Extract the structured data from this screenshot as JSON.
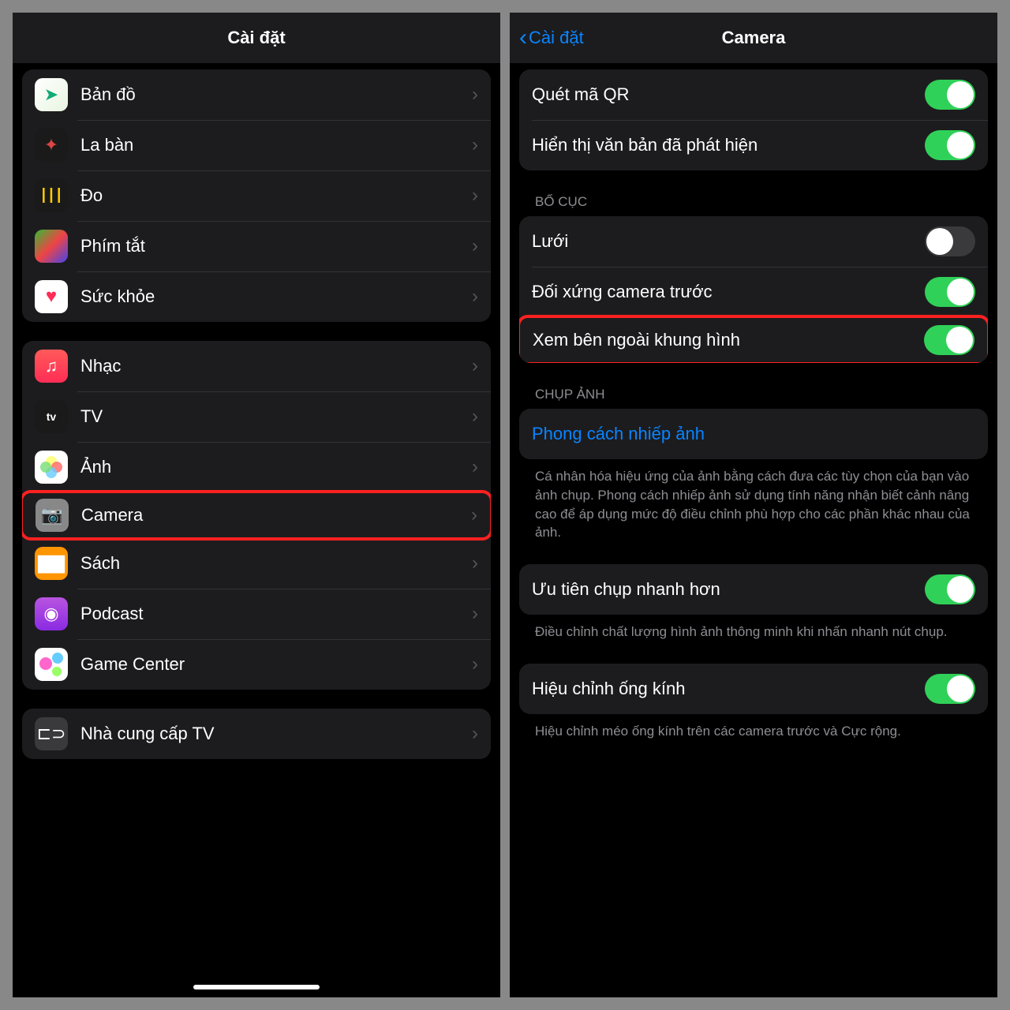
{
  "left": {
    "title": "Cài đặt",
    "group1": [
      {
        "label": "Bản đồ",
        "icon": "maps"
      },
      {
        "label": "La bàn",
        "icon": "compass"
      },
      {
        "label": "Đo",
        "icon": "measure"
      },
      {
        "label": "Phím tắt",
        "icon": "shortcuts"
      },
      {
        "label": "Sức khỏe",
        "icon": "health"
      }
    ],
    "group2": [
      {
        "label": "Nhạc",
        "icon": "music"
      },
      {
        "label": "TV",
        "icon": "tv"
      },
      {
        "label": "Ảnh",
        "icon": "photos"
      },
      {
        "label": "Camera",
        "icon": "camera",
        "highlight": true
      },
      {
        "label": "Sách",
        "icon": "books"
      },
      {
        "label": "Podcast",
        "icon": "podcast"
      },
      {
        "label": "Game Center",
        "icon": "gamecenter"
      }
    ],
    "group3": [
      {
        "label": "Nhà cung cấp TV",
        "icon": "tvprovider"
      }
    ]
  },
  "right": {
    "back": "Cài đặt",
    "title": "Camera",
    "group1": [
      {
        "label": "Quét mã QR",
        "on": true
      },
      {
        "label": "Hiển thị văn bản đã phát hiện",
        "on": true
      }
    ],
    "section_layout": "BỐ CỤC",
    "group2": [
      {
        "label": "Lưới",
        "on": false
      },
      {
        "label": "Đối xứng camera trước",
        "on": true
      },
      {
        "label": "Xem bên ngoài khung hình",
        "on": true,
        "highlight": true
      }
    ],
    "section_capture": "CHỤP ẢNH",
    "link_styles": "Phong cách nhiếp ảnh",
    "styles_desc": "Cá nhân hóa hiệu ứng của ảnh bằng cách đưa các tùy chọn của bạn vào ảnh chụp. Phong cách nhiếp ảnh sử dụng tính năng nhận biết cảnh nâng cao để áp dụng mức độ điều chỉnh phù hợp cho các phần khác nhau của ảnh.",
    "faster_label": "Ưu tiên chụp nhanh hơn",
    "faster_desc": "Điều chỉnh chất lượng hình ảnh thông minh khi nhấn nhanh nút chụp.",
    "lens_label": "Hiệu chỉnh ống kính",
    "lens_desc": "Hiệu chỉnh méo ống kính trên các camera trước và Cực rộng."
  }
}
